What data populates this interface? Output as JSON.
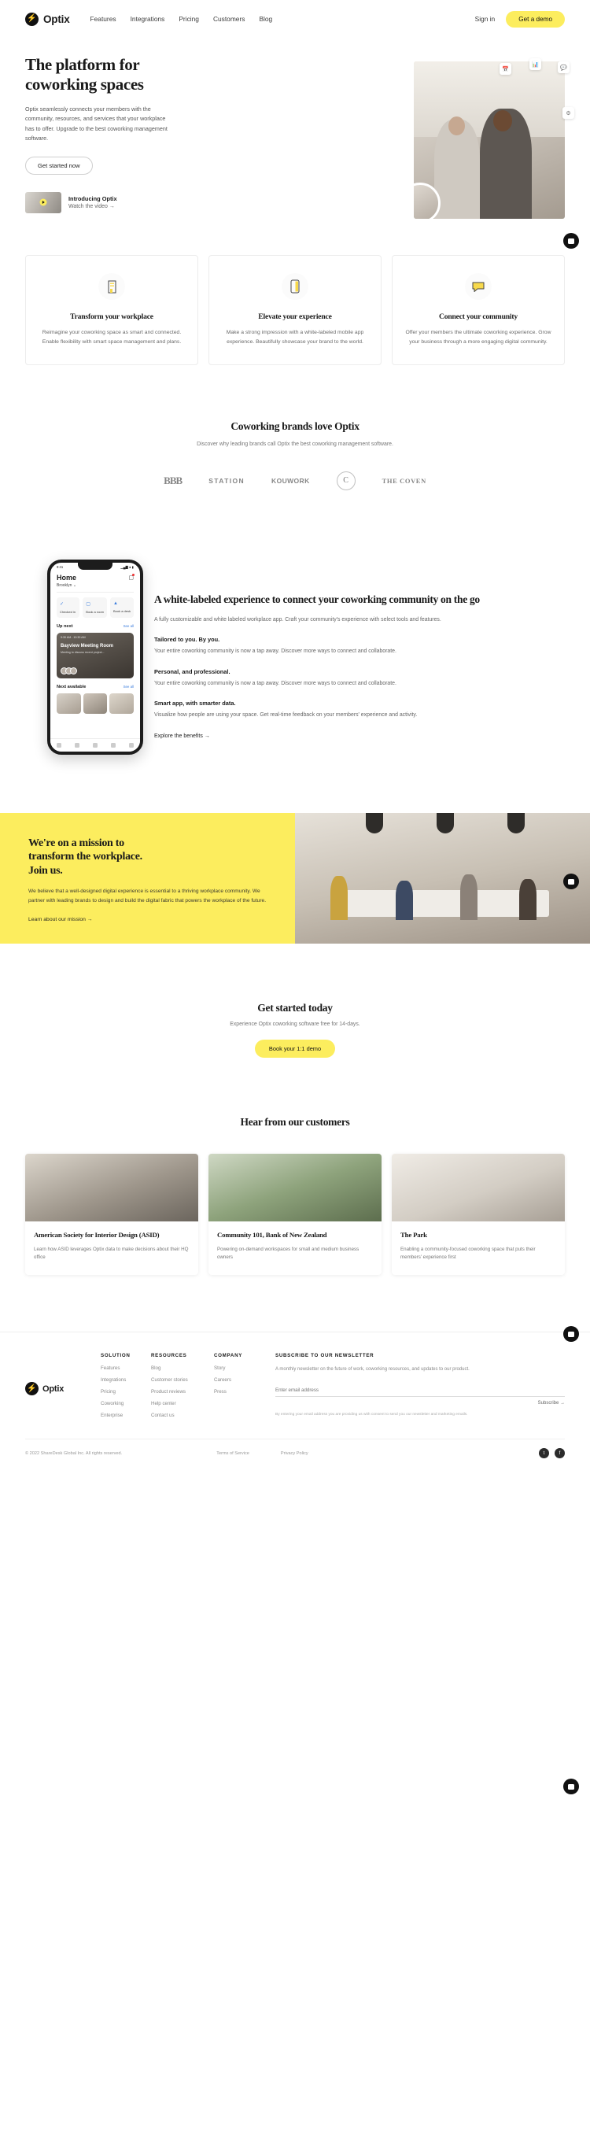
{
  "brand": {
    "name": "Optix",
    "mark": "lightning-bolt"
  },
  "header": {
    "nav": [
      {
        "label": "Features"
      },
      {
        "label": "Integrations"
      },
      {
        "label": "Pricing"
      },
      {
        "label": "Customers"
      },
      {
        "label": "Blog"
      }
    ],
    "signin": "Sign in",
    "demo": "Get a demo"
  },
  "hero": {
    "title_line1": "The platform for",
    "title_line2": "coworking spaces",
    "subtitle": "Optix seamlessly connects your members with the community, resources, and services that your workplace has to offer. Upgrade to the best coworking management software.",
    "cta": "Get started now",
    "video_title": "Introducing Optix",
    "video_link": "Watch the video →"
  },
  "features": [
    {
      "icon": "building-icon",
      "title": "Transform your workplace",
      "body": "Reimagine your coworking space as smart and connected. Enable flexibility with smart space management and plans."
    },
    {
      "icon": "mobile-phone-icon",
      "title": "Elevate your experience",
      "body": "Make a strong impression with a white-labeled mobile app experience. Beautifully showcase your brand to the world."
    },
    {
      "icon": "chat-heart-icon",
      "title": "Connect your community",
      "body": "Offer your members the ultimate coworking experience. Grow your business through a more engaging digital community."
    }
  ],
  "brands": {
    "title": "Coworking brands love Optix",
    "subtitle": "Discover why leading brands call Optix the best coworking management software.",
    "logos": [
      {
        "name": "BBB"
      },
      {
        "name": "STATION"
      },
      {
        "name": "KOUWORK"
      },
      {
        "name": "C"
      },
      {
        "name": "THE COVEN"
      }
    ]
  },
  "app": {
    "title": "A white-labeled experience to connect your coworking community on the go",
    "lead": "A fully customizable and white labeled workplace app. Craft your community's experience with select tools and features.",
    "points": [
      {
        "heading": "Tailored to you. By you.",
        "body": "Your entire coworking community is now a tap away. Discover more ways to connect and collaborate."
      },
      {
        "heading": "Personal, and professional.",
        "body": "Your entire coworking community is now a tap away. Discover more ways to connect and collaborate."
      },
      {
        "heading": "Smart app, with smarter data.",
        "body": "Visualize how people are using your space. Get real-time feedback on your members' experience and activity."
      }
    ],
    "link": "Explore the benefits →"
  },
  "phone": {
    "time": "9:41",
    "signal": "▮▮▮",
    "wifi": "wifi-icon",
    "battery": "battery-icon",
    "title": "Home",
    "message_icon": "message-icon",
    "location": "Brooklyn ⌄",
    "tiles": [
      {
        "icon": "check-circle-icon",
        "label": "Checked in"
      },
      {
        "icon": "cube-icon",
        "label": "Book a room"
      },
      {
        "icon": "desk-icon",
        "label": "Book a desk"
      }
    ],
    "upnext_label": "Up next",
    "upnext_seeall": "See all",
    "event_time": "9:30 AM - 10:30 AM",
    "event_title": "Bayview Meeting Room",
    "event_sub": "Meeting to discuss recent project...",
    "next_label": "Next available",
    "next_seeall": "See all"
  },
  "mission": {
    "title_line1": "We're on a mission to",
    "title_line2": "transform the workplace.",
    "title_line3": "Join us.",
    "body": "We believe that a well-designed digital experience is essential to a thriving workplace community. We partner with leading brands to design and build the digital fabric that powers the workplace of the future.",
    "link": "Learn about our mission →"
  },
  "started": {
    "title": "Get started today",
    "subtitle": "Experience Optix coworking software free for 14-days.",
    "cta": "Book your 1:1 demo"
  },
  "customers": {
    "title": "Hear from our customers",
    "cards": [
      {
        "title": "American Society for Interior Design (ASID)",
        "desc": "Learn how ASID leverages Optix data to make decisions about their HQ office"
      },
      {
        "title": "Community 101, Bank of New Zealand",
        "desc": "Powering on-demand workspaces for small and medium business owners"
      },
      {
        "title": "The Park",
        "desc": "Enabling a community-focused coworking space that puts their members' experience first"
      }
    ]
  },
  "footer": {
    "columns": [
      {
        "heading": "SOLUTION",
        "links": [
          {
            "label": "Features"
          },
          {
            "label": "Integrations"
          },
          {
            "label": "Pricing"
          },
          {
            "label": "Coworking"
          },
          {
            "label": "Enterprise"
          }
        ]
      },
      {
        "heading": "RESOURCES",
        "links": [
          {
            "label": "Blog"
          },
          {
            "label": "Customer stories"
          },
          {
            "label": "Product reviews"
          },
          {
            "label": "Help center"
          },
          {
            "label": "Contact us"
          }
        ]
      },
      {
        "heading": "COMPANY",
        "links": [
          {
            "label": "Story"
          },
          {
            "label": "Careers"
          },
          {
            "label": "Press"
          }
        ]
      }
    ],
    "newsletter": {
      "heading": "SUBSCRIBE TO OUR NEWSLETTER",
      "body": "A monthly newsletter on the future of work, coworking resources, and updates to our product.",
      "placeholder": "Enter email address",
      "button": "Subscribe →",
      "fine": "By entering your email address you are providing us with consent to send you our newsletter and marketing emails."
    },
    "copyright": "© 2022 ShareDesk Global Inc. All rights reserved.",
    "legal": [
      {
        "label": "Terms of Service"
      },
      {
        "label": "Privacy Policy"
      }
    ],
    "social": [
      {
        "name": "twitter-icon",
        "glyph": "t"
      },
      {
        "name": "facebook-icon",
        "glyph": "f"
      }
    ]
  },
  "fabs": [
    {
      "name": "chat-widget-button"
    },
    {
      "name": "chat-widget-button"
    },
    {
      "name": "chat-widget-button"
    },
    {
      "name": "chat-widget-button"
    }
  ]
}
